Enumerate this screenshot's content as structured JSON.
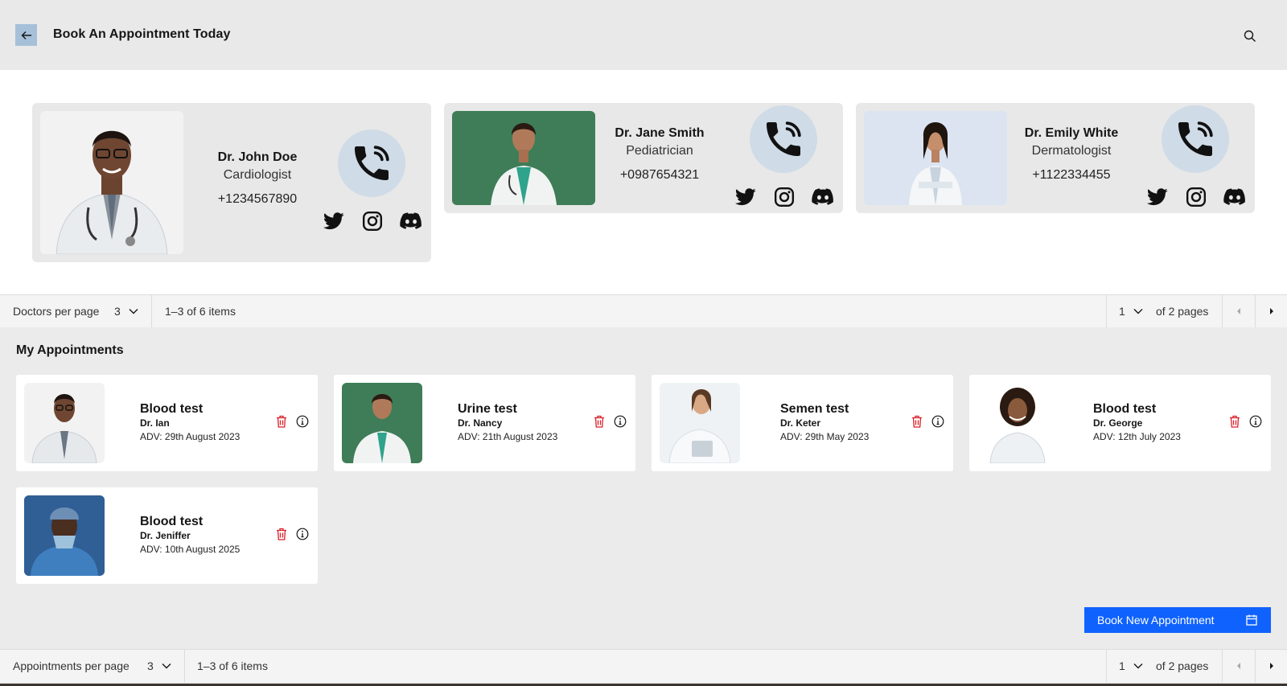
{
  "header": {
    "title": "Book An Appointment Today",
    "back_icon": "arrow-left-icon",
    "search_icon": "search-icon"
  },
  "doctors": [
    {
      "name": "Dr. John Doe",
      "specialty": "Cardiologist",
      "phone": "+1234567890",
      "photo_bg": "#f2f2f2"
    },
    {
      "name": "Dr. Jane Smith",
      "specialty": "Pediatrician",
      "phone": "+0987654321",
      "photo_bg": "#3e7d57"
    },
    {
      "name": "Dr. Emily White",
      "specialty": "Dermatologist",
      "phone": "+1122334455",
      "photo_bg": "#dbe4f0"
    }
  ],
  "doctors_pager": {
    "per_page_label": "Doctors per page",
    "per_page_value": "3",
    "range": "1–3 of 6 items",
    "page": "1",
    "of_pages": "of 2 pages"
  },
  "appointments_title": "My Appointments",
  "appointments": [
    {
      "test": "Blood test",
      "doctor": "Dr. Ian",
      "date": "ADV: 29th August 2023",
      "photo_bg": "#f2f2f2"
    },
    {
      "test": "Urine test",
      "doctor": "Dr. Nancy",
      "date": "ADV: 21th August 2023",
      "photo_bg": "#3e7d57"
    },
    {
      "test": "Semen test",
      "doctor": "Dr. Keter",
      "date": "ADV: 29th May 2023",
      "photo_bg": "#eef2f5"
    },
    {
      "test": "Blood test",
      "doctor": "Dr. George",
      "date": "ADV: 12th July 2023",
      "photo_bg": "#ffffff"
    },
    {
      "test": "Blood test",
      "doctor": "Dr. Jeniffer",
      "date": "ADV: 10th August 2025",
      "photo_bg": "#3b6ea8"
    }
  ],
  "book_button": {
    "label": "Book New Appointment",
    "icon": "calendar-icon"
  },
  "appointments_pager": {
    "per_page_label": "Appointments per page",
    "per_page_value": "3",
    "range": "1–3 of 6 items",
    "page": "1",
    "of_pages": "of 2 pages"
  },
  "colors": {
    "primary": "#0f62fe",
    "danger": "#da1e28",
    "call_bg": "#cfdbe6",
    "back_btn_bg": "#a6c0d9"
  }
}
